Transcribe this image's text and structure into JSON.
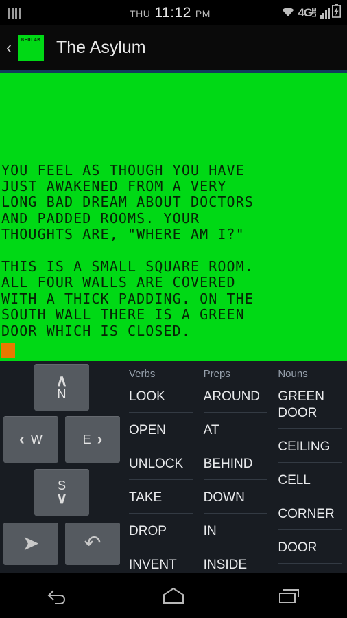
{
  "status_bar": {
    "left_icon": "equalizer-bars-icon",
    "day_of_week": "THU",
    "time": "11:12",
    "am_pm": "PM",
    "wifi_icon": "wifi-icon",
    "network_type": "4G",
    "network_sub": "LTE",
    "signal_icon": "signal-bars-icon",
    "battery_icon": "battery-charging-icon"
  },
  "app_bar": {
    "back_chevron": "‹",
    "app_icon_label": "BEDLAM",
    "title": "The Asylum",
    "accent_color": "#123a5c"
  },
  "terminal": {
    "background_color": "#00d915",
    "text_color": "#062506",
    "cursor_color": "#e87a00",
    "body": "YOU FEEL AS THOUGH YOU HAVE\nJUST AWAKENED FROM A VERY\nLONG BAD DREAM ABOUT DOCTORS\nAND PADDED ROOMS. YOUR\nTHOUGHTS ARE, \"WHERE AM I?\"\n\nTHIS IS A SMALL SQUARE ROOM.\nALL FOUR WALLS ARE COVERED\nWITH A THICK PADDING. ON THE\nSOUTH WALL THERE IS A GREEN\nDOOR WHICH IS CLOSED."
  },
  "dpad": {
    "north": {
      "label": "N",
      "chevron": "∧"
    },
    "west": {
      "label": "W",
      "chevron": "‹"
    },
    "east": {
      "label": "E",
      "chevron": "›"
    },
    "south": {
      "label": "S",
      "chevron": "∨"
    },
    "send": {
      "glyph": "➤"
    },
    "undo": {
      "glyph": "↶"
    }
  },
  "word_lists": [
    {
      "header": "Verbs",
      "items": [
        "LOOK",
        "OPEN",
        "UNLOCK",
        "TAKE",
        "DROP",
        "INVENT"
      ]
    },
    {
      "header": "Preps",
      "items": [
        "AROUND",
        "AT",
        "BEHIND",
        "DOWN",
        "IN",
        "INSIDE"
      ]
    },
    {
      "header": "Nouns",
      "items": [
        "GREEN DOOR",
        "CEILING",
        "CELL",
        "CORNER",
        "DOOR"
      ]
    }
  ],
  "nav_bar": {
    "back": "back-icon",
    "home": "home-icon",
    "recents": "recent-apps-icon"
  }
}
